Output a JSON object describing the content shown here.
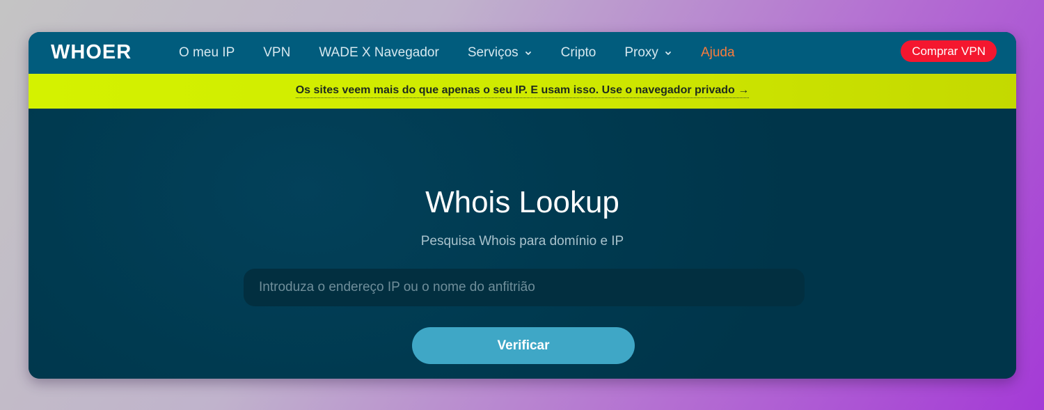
{
  "brand": {
    "logo_text": "WHOER"
  },
  "nav": {
    "items": [
      {
        "label": "O meu IP",
        "dropdown": false
      },
      {
        "label": "VPN",
        "dropdown": false
      },
      {
        "label": "WADE X Navegador",
        "dropdown": false
      },
      {
        "label": "Serviços",
        "dropdown": true
      },
      {
        "label": "Cripto",
        "dropdown": false
      },
      {
        "label": "Proxy",
        "dropdown": true
      },
      {
        "label": "Ajuda",
        "dropdown": false,
        "highlight_color": "#f97c3c"
      }
    ],
    "cta_label": "Comprar VPN",
    "cta_color": "#f4172f"
  },
  "banner": {
    "text": "Os sites veem mais do que apenas o seu IP. E usam isso. Use o navegador privado →",
    "color": "#d4f200"
  },
  "hero": {
    "title": "Whois Lookup",
    "subtitle": "Pesquisa Whois para domínio e IP",
    "search": {
      "value": "",
      "placeholder": "Introduza o endereço IP ou o nome do anfitrião"
    },
    "submit_label": "Verificar",
    "submit_color": "#3fa7c6"
  },
  "colors": {
    "navbar": "#015c7d",
    "hero_bg": "#00364b"
  }
}
